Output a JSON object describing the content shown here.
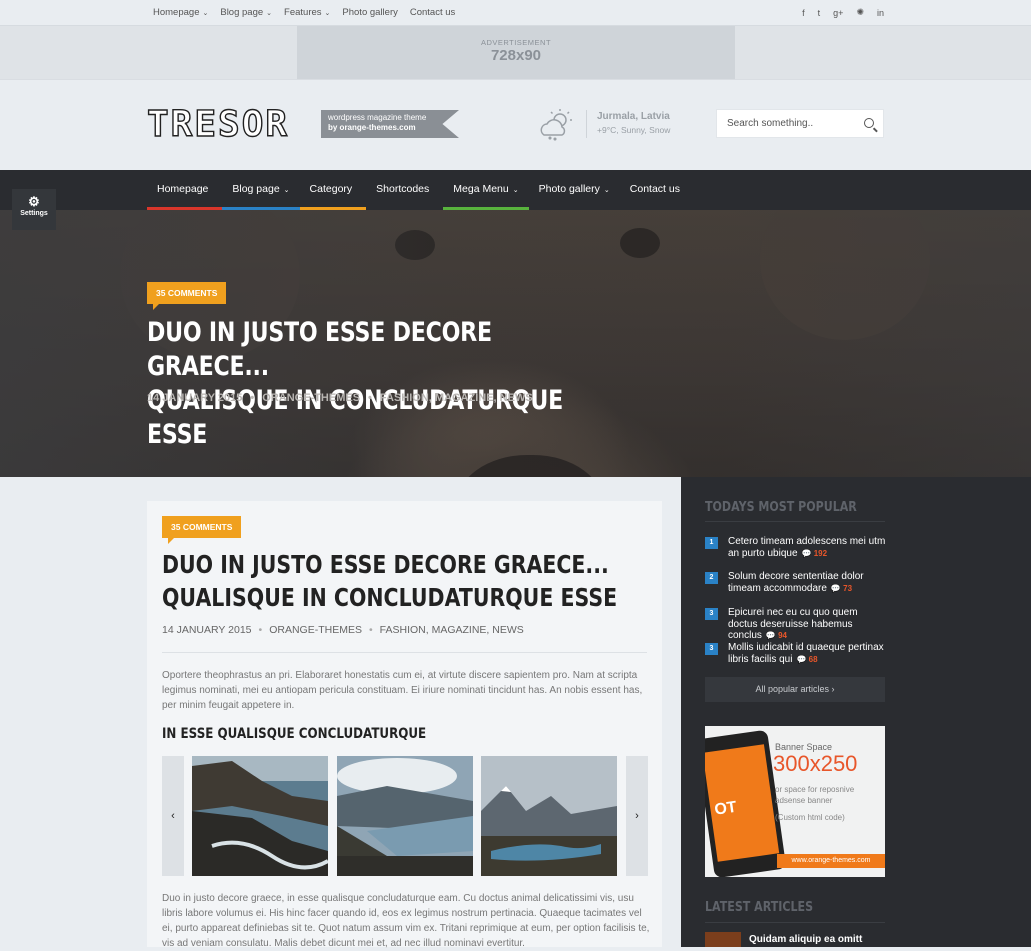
{
  "topbar": {
    "links": [
      {
        "label": "Homepage",
        "caret": "⌄"
      },
      {
        "label": "Blog page",
        "caret": "⌄"
      },
      {
        "label": "Features",
        "caret": "⌄"
      },
      {
        "label": "Photo gallery",
        "caret": ""
      },
      {
        "label": "Contact us",
        "caret": ""
      }
    ],
    "social": [
      "f",
      "t",
      "g+",
      "✺",
      "in"
    ]
  },
  "ad": {
    "label": "ADVERTISEMENT",
    "size": "728x90"
  },
  "header": {
    "logo": "TRESOR",
    "tagline_line1": "wordpress magazine theme",
    "tagline_line2": "by orange-themes.com",
    "weather_city": "Jurmala, Latvia",
    "weather_temp": "+9°C, Sunny, Snow",
    "search_placeholder": "Search something.."
  },
  "nav": {
    "items": [
      {
        "label": "Homepage",
        "caret": "",
        "color": "#d9362b"
      },
      {
        "label": "Blog page",
        "caret": "⌄",
        "color": "#2a82c6"
      },
      {
        "label": "Category",
        "caret": "",
        "color": "#f0a01e"
      },
      {
        "label": "Shortcodes",
        "caret": "",
        "color": ""
      },
      {
        "label": "Mega Menu",
        "caret": "⌄",
        "color": "#58b33d"
      },
      {
        "label": "Photo gallery",
        "caret": "⌄",
        "color": ""
      },
      {
        "label": "Contact us",
        "caret": "",
        "color": ""
      }
    ]
  },
  "settings": {
    "label": "Settings"
  },
  "hero": {
    "comments": "35 COMMENTS",
    "title_line1": "DUO IN JUSTO ESSE DECORE GRAECE...",
    "title_line2": "QUALISQUE IN CONCLUDATURQUE ESSE",
    "date": "14 JANUARY 2015",
    "author": "ORANGE-THEMES",
    "categories": "FASHION, MAGAZINE, NEWS"
  },
  "article": {
    "comments": "35 COMMENTS",
    "title_line1": "DUO IN JUSTO ESSE DECORE GRAECE...",
    "title_line2": "QUALISQUE IN CONCLUDATURQUE ESSE",
    "date": "14 JANUARY 2015",
    "author": "ORANGE-THEMES",
    "categories": "FASHION, MAGAZINE, NEWS",
    "intro": "Oportere theophrastus an pri. Elaboraret honestatis cum ei, at virtute discere sapientem pro. Nam at scripta legimus nominati, mei eu antiopam pericula constituam. Ei iriure nominati tincidunt has. An nobis essent has, per minim feugait appetere in.",
    "subheading": "IN ESSE QUALISQUE CONCLUDATURQUE",
    "gallery_prev": "‹",
    "gallery_next": "›",
    "body": "Duo in justo decore graece, in esse qualisque concludaturque eam. Cu doctus animal delicatissimi vis, usu libris labore volumus ei. His hinc facer quando id, eos ex legimus nostrum pertinacia. Quaeque tacimates vel ei, purto appareat definiebas sit te. Quot natum assum vim ex. Tritani reprimique at eum, per option facilisis te, vis ad veniam consulatu. Malis debet dicunt mei et, ad nec illud nominavi evertitur."
  },
  "sidebar": {
    "popular_heading": "TODAYS MOST POPULAR",
    "popular": [
      {
        "num": "1",
        "title": "Cetero timeam adolescens mei utm an purto ubique",
        "count": "192"
      },
      {
        "num": "2",
        "title": "Solum decore sententiae dolor timeam accommodare",
        "count": "73"
      },
      {
        "num": "3",
        "title": "Epicurei nec eu cu quo quem doctus deseruisse habemus conclus",
        "count": "94"
      },
      {
        "num": "3",
        "title": "Mollis iudicabit id quaeque pertinax libris facilis qui",
        "count": "68"
      }
    ],
    "all_popular": "All popular articles ›",
    "banner": {
      "line1": "Banner Space",
      "size": "300x250",
      "line3": "or space for reposnive adsense banner",
      "line4": "(Custom html code)",
      "site": "www.orange-themes.com",
      "phone_text": "OT"
    },
    "latest_heading": "LATEST ARTICLES",
    "latest": [
      {
        "title": "Quidam aliquip ea omitt"
      }
    ]
  },
  "colors": {
    "accent_orange": "#f0a01e",
    "nav_bg": "#2a2c30",
    "link_blue": "#2a82c6",
    "count_red": "#e8562a"
  }
}
